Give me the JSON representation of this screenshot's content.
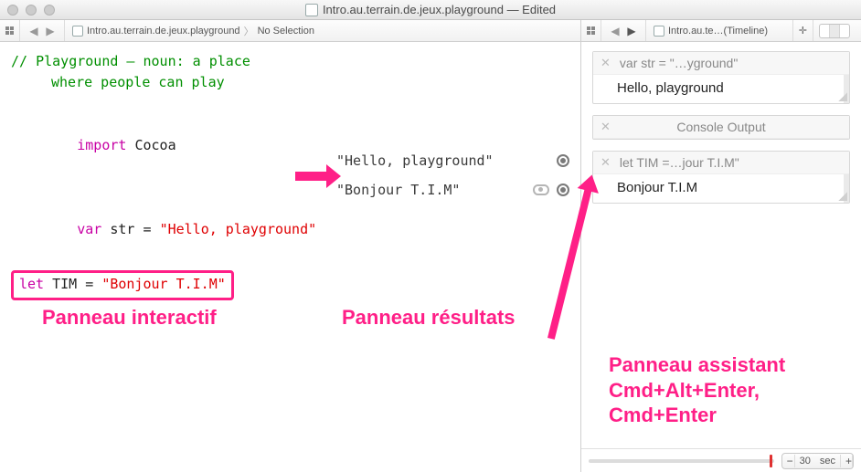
{
  "titlebar": {
    "title": "Intro.au.terrain.de.jeux.playground — Edited"
  },
  "jumpbar": {
    "main": {
      "file": "Intro.au.terrain.de.jeux.playground",
      "selection": "No Selection"
    },
    "side": {
      "file": "Intro.au.te…(Timeline)"
    }
  },
  "code": {
    "c1a": "// Playground – noun: a place",
    "c1b": "where people can play",
    "imp_kw": "import",
    "imp_mod": " Cocoa",
    "var_kw": "var",
    "var_rest": " str = ",
    "var_str": "\"Hello, playground\"",
    "let_kw": "let",
    "let_rest": " TIM = ",
    "let_str": "\"Bonjour T.I.M\""
  },
  "results": {
    "r1": "\"Hello, playground\"",
    "r2": "\"Bonjour T.I.M\""
  },
  "assistant": {
    "cards": [
      {
        "head": "var str = \"…yground\"",
        "body": "Hello, playground"
      },
      {
        "head": "Console Output",
        "body": ""
      },
      {
        "head": "let TIM =…jour T.I.M\"",
        "body": "Bonjour T.I.M"
      }
    ],
    "timeline": {
      "value": "30",
      "unit": "sec"
    }
  },
  "annotations": {
    "leftPanel": "Panneau interactif",
    "resultsPanel": "Panneau résultats",
    "assistantPanel": "Panneau assistant\nCmd+Alt+Enter,\nCmd+Enter"
  }
}
